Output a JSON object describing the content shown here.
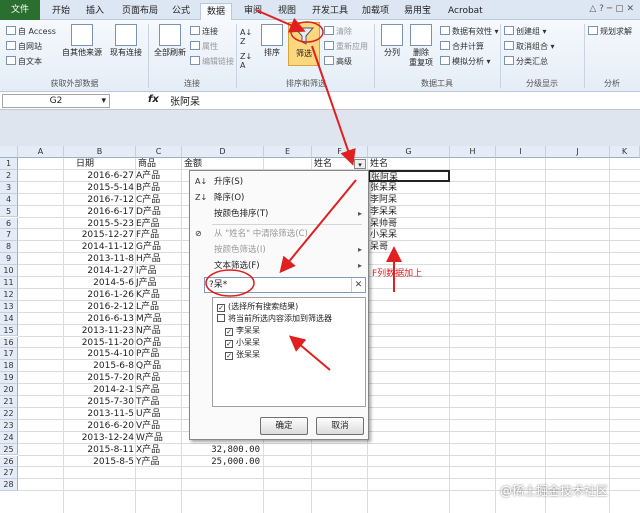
{
  "tabs": [
    "文件",
    "开始",
    "插入",
    "页面布局",
    "公式",
    "数据",
    "审阅",
    "视图",
    "开发工具",
    "加载项",
    "易用宝",
    "Acrobat"
  ],
  "ribbon": {
    "get_external": {
      "access": "自 Access",
      "web": "自网站",
      "text": "自文本",
      "other": "自其他来源",
      "existing": "现有连接",
      "label": "获取外部数据"
    },
    "connections": {
      "refresh": "全部刷新",
      "conn": "连接",
      "props": "属性",
      "edit_links": "编辑链接",
      "label": "连接"
    },
    "sort_filter": {
      "sort": "排序",
      "filter": "筛选",
      "clear": "清除",
      "reapply": "重新应用",
      "advanced": "高级",
      "label": "排序和筛选"
    },
    "tools": {
      "split": "分列",
      "remove_dup": "删除\n重复项",
      "validation": "数据有效性",
      "consolidate": "合并计算",
      "whatif": "模拟分析",
      "label": "数据工具"
    },
    "outline": {
      "group": "创建组",
      "ungroup": "取消组合",
      "subtotal": "分类汇总",
      "label": "分级显示"
    },
    "analysis": {
      "solver": "规划求解",
      "label": "分析"
    }
  },
  "formula_bar": {
    "name_box": "G2",
    "fx": "fx",
    "value": "张阿呆"
  },
  "columns": [
    "A",
    "B",
    "C",
    "D",
    "E",
    "F",
    "G",
    "H",
    "I",
    "J",
    "K"
  ],
  "rows": [
    "1",
    "2",
    "3",
    "4",
    "5",
    "6",
    "7",
    "8",
    "9",
    "10",
    "11",
    "12",
    "13",
    "14",
    "15",
    "16",
    "17",
    "18",
    "19",
    "20",
    "21",
    "22",
    "23",
    "24",
    "25",
    "26",
    "27",
    "28"
  ],
  "headers": {
    "date": "日期",
    "product": "商品",
    "amount": "金额",
    "name": "姓名",
    "g_name": "姓名"
  },
  "table": [
    {
      "date": "2016-6-27",
      "prod": "A产品"
    },
    {
      "date": "2015-5-14",
      "prod": "B产品"
    },
    {
      "date": "2016-7-12",
      "prod": "C产品"
    },
    {
      "date": "2016-6-17",
      "prod": "D产品"
    },
    {
      "date": "2015-5-23",
      "prod": "E产品"
    },
    {
      "date": "2015-12-27",
      "prod": "F产品"
    },
    {
      "date": "2014-11-12",
      "prod": "G产品"
    },
    {
      "date": "2013-11-8",
      "prod": "H产品"
    },
    {
      "date": "2014-1-27",
      "prod": "I产品"
    },
    {
      "date": "2014-5-6",
      "prod": "J产品"
    },
    {
      "date": "2016-1-26",
      "prod": "K产品"
    },
    {
      "date": "2016-2-12",
      "prod": "L产品"
    },
    {
      "date": "2016-6-13",
      "prod": "M产品"
    },
    {
      "date": "2013-11-23",
      "prod": "N产品"
    },
    {
      "date": "2015-11-20",
      "prod": "O产品"
    },
    {
      "date": "2015-4-10",
      "prod": "P产品"
    },
    {
      "date": "2015-6-8",
      "prod": "Q产品"
    },
    {
      "date": "2015-7-20",
      "prod": "R产品"
    },
    {
      "date": "2014-2-1",
      "prod": "S产品"
    },
    {
      "date": "2015-7-30",
      "prod": "T产品"
    },
    {
      "date": "2013-11-5",
      "prod": "U产品"
    },
    {
      "date": "2016-6-20",
      "prod": "V产品"
    },
    {
      "date": "2013-12-24",
      "prod": "W产品"
    },
    {
      "date": "2015-8-11",
      "prod": "X产品",
      "amount": "32,800.00"
    },
    {
      "date": "2015-8-5",
      "prod": "Y产品",
      "amount": "25,000.00"
    }
  ],
  "g_values": [
    "张阿呆",
    "张呆呆",
    "李阿呆",
    "李呆呆",
    "呆帅哥",
    "小呆呆",
    "呆哥"
  ],
  "dropdown": {
    "sort_asc": "升序(S)",
    "sort_desc": "降序(O)",
    "sort_color": "按颜色排序(T)",
    "clear": "从 \"姓名\" 中清除筛选(C)",
    "filter_color": "按颜色筛选(I)",
    "text_filter": "文本筛选(F)",
    "search_value": "?呆*",
    "items": [
      {
        "label": "(选择所有搜索结果)",
        "checked": true
      },
      {
        "label": "将当前所选内容添加到筛选器",
        "checked": false
      },
      {
        "label": "李呆呆",
        "checked": true
      },
      {
        "label": "小呆呆",
        "checked": true
      },
      {
        "label": "张呆呆",
        "checked": true
      }
    ],
    "ok": "确定",
    "cancel": "取消"
  },
  "annotation": "F列数据加上",
  "watermark": "@稀土掘金技术社区",
  "colors": {
    "accent": "#e02020",
    "file_tab": "#2a6f2f"
  }
}
